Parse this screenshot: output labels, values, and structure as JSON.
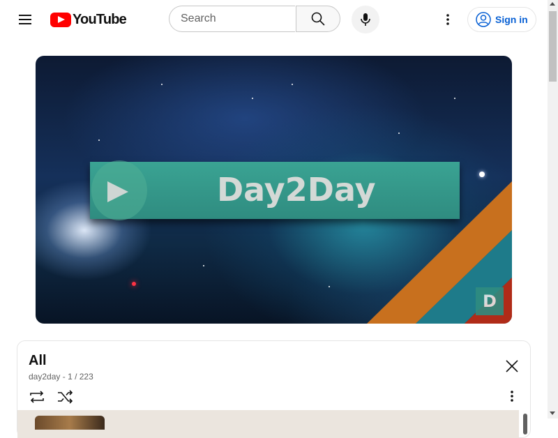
{
  "header": {
    "logo_text": "YouTube",
    "search_placeholder": "Search",
    "signin_label": "Sign in"
  },
  "player": {
    "banner_text": "Day2Day",
    "corner_logo": "D"
  },
  "playlist": {
    "title": "All",
    "channel": "day2day",
    "position": "1 / 223"
  },
  "colors": {
    "brand_red": "#ff0000",
    "link_blue": "#065fd4",
    "banner_teal": "#3aa393"
  },
  "icons": [
    "menu-icon",
    "search-icon",
    "microphone-icon",
    "more-vert-icon",
    "account-icon",
    "close-icon",
    "loop-icon",
    "shuffle-icon"
  ]
}
